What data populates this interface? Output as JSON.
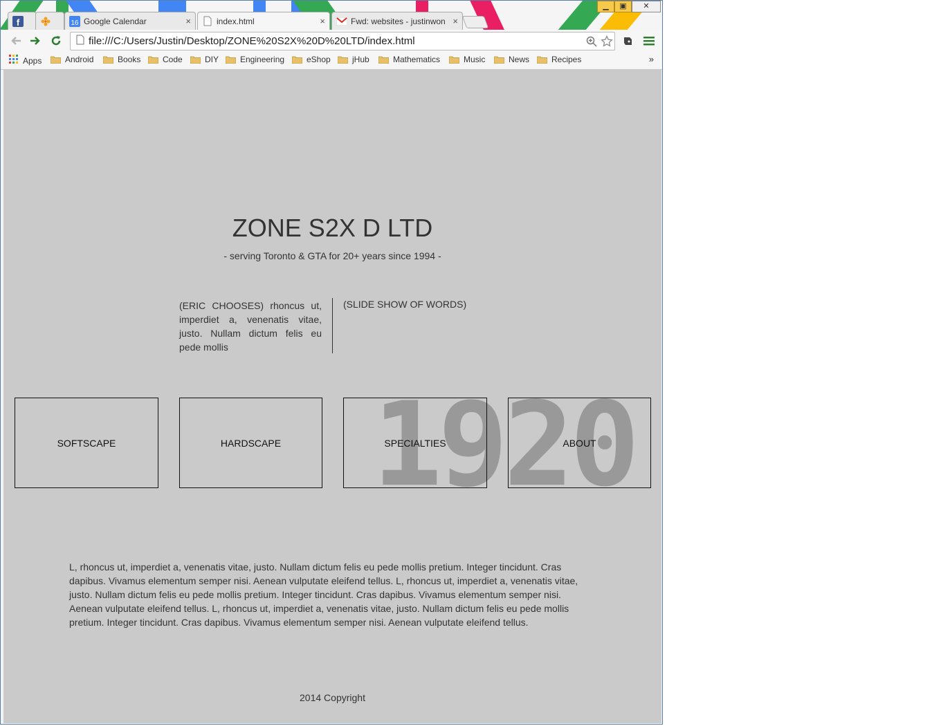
{
  "browser": {
    "tabs": [
      {
        "title": "",
        "icon": "facebook-icon",
        "active": false
      },
      {
        "title": "",
        "icon": "pinwheel-icon",
        "active": false
      },
      {
        "title": "Google Calendar",
        "icon": "calendar-icon",
        "badge": "16",
        "active": false
      },
      {
        "title": "index.html",
        "icon": "document-icon",
        "active": true
      },
      {
        "title": "Fwd: websites - justinwon",
        "icon": "gmail-icon",
        "active": false
      }
    ],
    "url": "file:///C:/Users/Justin/Desktop/ZONE%20S2X%20D%20LTD/index.html",
    "bookmarks": [
      "Apps",
      "Android",
      "Books",
      "Code",
      "DIY",
      "Engineering",
      "eShop",
      "jHub",
      "Mathematics",
      "Music",
      "News",
      "Recipes"
    ],
    "more": "»",
    "colors": {
      "folder": "#e8c06a",
      "facebook": "#3b5998",
      "calendar": "#4285f4",
      "gmail": "#d93025"
    }
  },
  "page": {
    "title": "ZONE S2X D LTD",
    "tagline": "- serving Toronto & GTA for 20+ years since 1994 -",
    "intro_left": "(ERIC CHOOSES) rhoncus ut, imperdiet a, venenatis vitae, justo. Nullam dictum felis eu pede mollis",
    "intro_right": "(SLIDE SHOW OF WORDS)",
    "watermark": "1920 x",
    "nav_boxes": [
      "SOFTSCAPE",
      "HARDSCAPE",
      "SPECIALTIES",
      "ABOUT"
    ],
    "body_text": "L, rhoncus ut, imperdiet a, venenatis vitae, justo. Nullam dictum felis eu pede mollis pretium. Integer tincidunt. Cras dapibus. Vivamus elementum semper nisi. Aenean vulputate eleifend tellus. L, rhoncus ut, imperdiet a, venenatis vitae, justo. Nullam dictum felis eu pede mollis pretium. Integer tincidunt. Cras dapibus. Vivamus elementum semper nisi. Aenean vulputate eleifend tellus. L, rhoncus ut, imperdiet a, venenatis vitae, justo. Nullam dictum felis eu pede mollis pretium. Integer tincidunt. Cras dapibus. Vivamus elementum semper nisi. Aenean vulputate eleifend tellus.",
    "footer": "2014 Copyright",
    "background": "#cacaca"
  }
}
